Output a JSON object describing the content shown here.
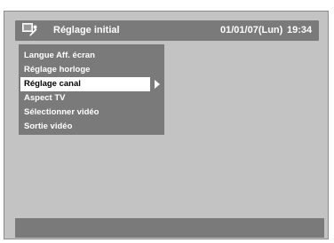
{
  "header": {
    "icon": "settings-tool-icon",
    "title": "Réglage initial",
    "date": "01/01/07(Lun)",
    "time": "19:34"
  },
  "menu": {
    "items": [
      {
        "label": "Langue Aff. écran",
        "selected": false
      },
      {
        "label": "Réglage horloge",
        "selected": false
      },
      {
        "label": "Réglage canal",
        "selected": true
      },
      {
        "label": "Aspect TV",
        "selected": false
      },
      {
        "label": "Sélectionner vidéo",
        "selected": false
      },
      {
        "label": "Sortie vidéo",
        "selected": false
      }
    ]
  },
  "colors": {
    "background": "#c3c3c3",
    "panel": "#7a7a7a",
    "highlight": "#ffffff"
  }
}
